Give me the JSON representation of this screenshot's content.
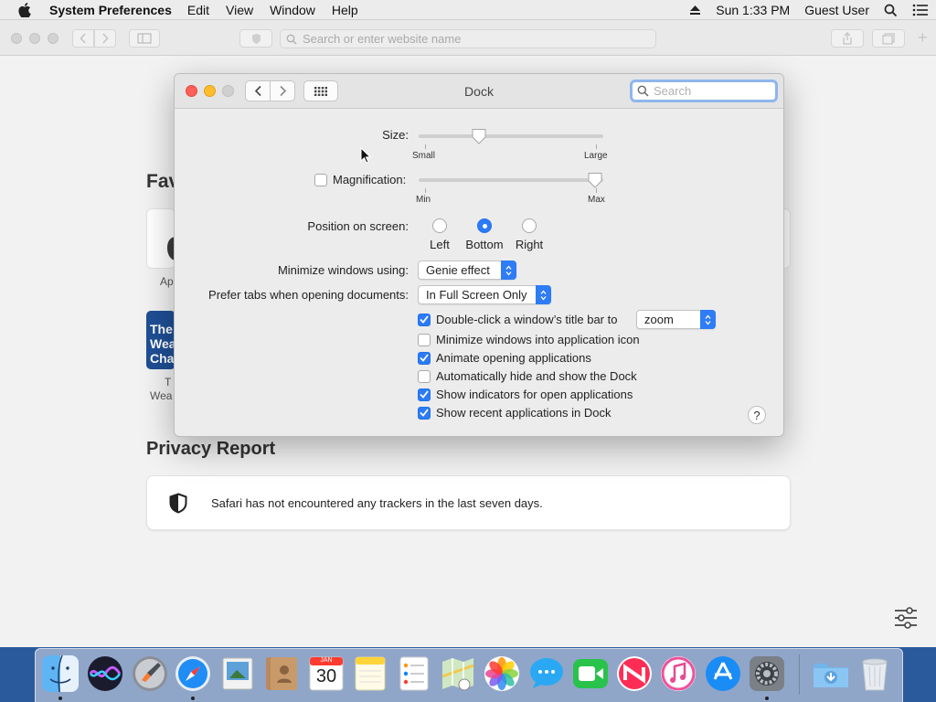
{
  "menubar": {
    "app_name": "System Preferences",
    "menus": [
      "Edit",
      "View",
      "Window",
      "Help"
    ],
    "clock": "Sun 1:33 PM",
    "user": "Guest User"
  },
  "safari": {
    "url_placeholder": "Search or enter website name",
    "favorites_title": "Fav",
    "favorites": [
      {
        "label_fragment": "Ap"
      },
      {
        "tile_text": [
          "The",
          "Wea",
          "Cha"
        ],
        "label_fragment": [
          "T",
          "Wea"
        ]
      }
    ],
    "privacy_title": "Privacy Report",
    "privacy_text": "Safari has not encountered any trackers in the last seven days."
  },
  "dock_prefs": {
    "window_title": "Dock",
    "search_placeholder": "Search",
    "size": {
      "label": "Size:",
      "min_label": "Small",
      "max_label": "Large",
      "value_percent": 33
    },
    "magnification": {
      "label": "Magnification:",
      "checked": false,
      "min_label": "Min",
      "max_label": "Max",
      "value_percent": 100
    },
    "position": {
      "label": "Position on screen:",
      "options": [
        "Left",
        "Bottom",
        "Right"
      ],
      "selected": "Bottom"
    },
    "minimize_using": {
      "label": "Minimize windows using:",
      "value": "Genie effect"
    },
    "prefer_tabs": {
      "label": "Prefer tabs when opening documents:",
      "value": "In Full Screen Only"
    },
    "checkboxes": [
      {
        "label": "Double-click a window’s title bar to",
        "checked": true,
        "popup_value": "zoom"
      },
      {
        "label": "Minimize windows into application icon",
        "checked": false
      },
      {
        "label": "Animate opening applications",
        "checked": true
      },
      {
        "label": "Automatically hide and show the Dock",
        "checked": false
      },
      {
        "label": "Show indicators for open applications",
        "checked": true
      },
      {
        "label": "Show recent applications in Dock",
        "checked": true
      }
    ],
    "help_label": "?"
  },
  "dock": {
    "items": [
      "finder-icon",
      "siri-icon",
      "launchpad-icon",
      "safari-icon",
      "preview-icon",
      "contacts-icon",
      "calendar-icon",
      "notes-icon",
      "reminders-icon",
      "maps-icon",
      "photos-icon",
      "messages-icon",
      "facetime-icon",
      "news-icon",
      "itunes-icon",
      "app-store-icon",
      "system-preferences-icon",
      "downloads-folder-icon",
      "trash-icon"
    ],
    "calendar_month": "JAN",
    "calendar_day": "30"
  },
  "colors": {
    "accent": "#2b7bf6",
    "close": "#fe5f57",
    "minimize": "#febc2e"
  }
}
